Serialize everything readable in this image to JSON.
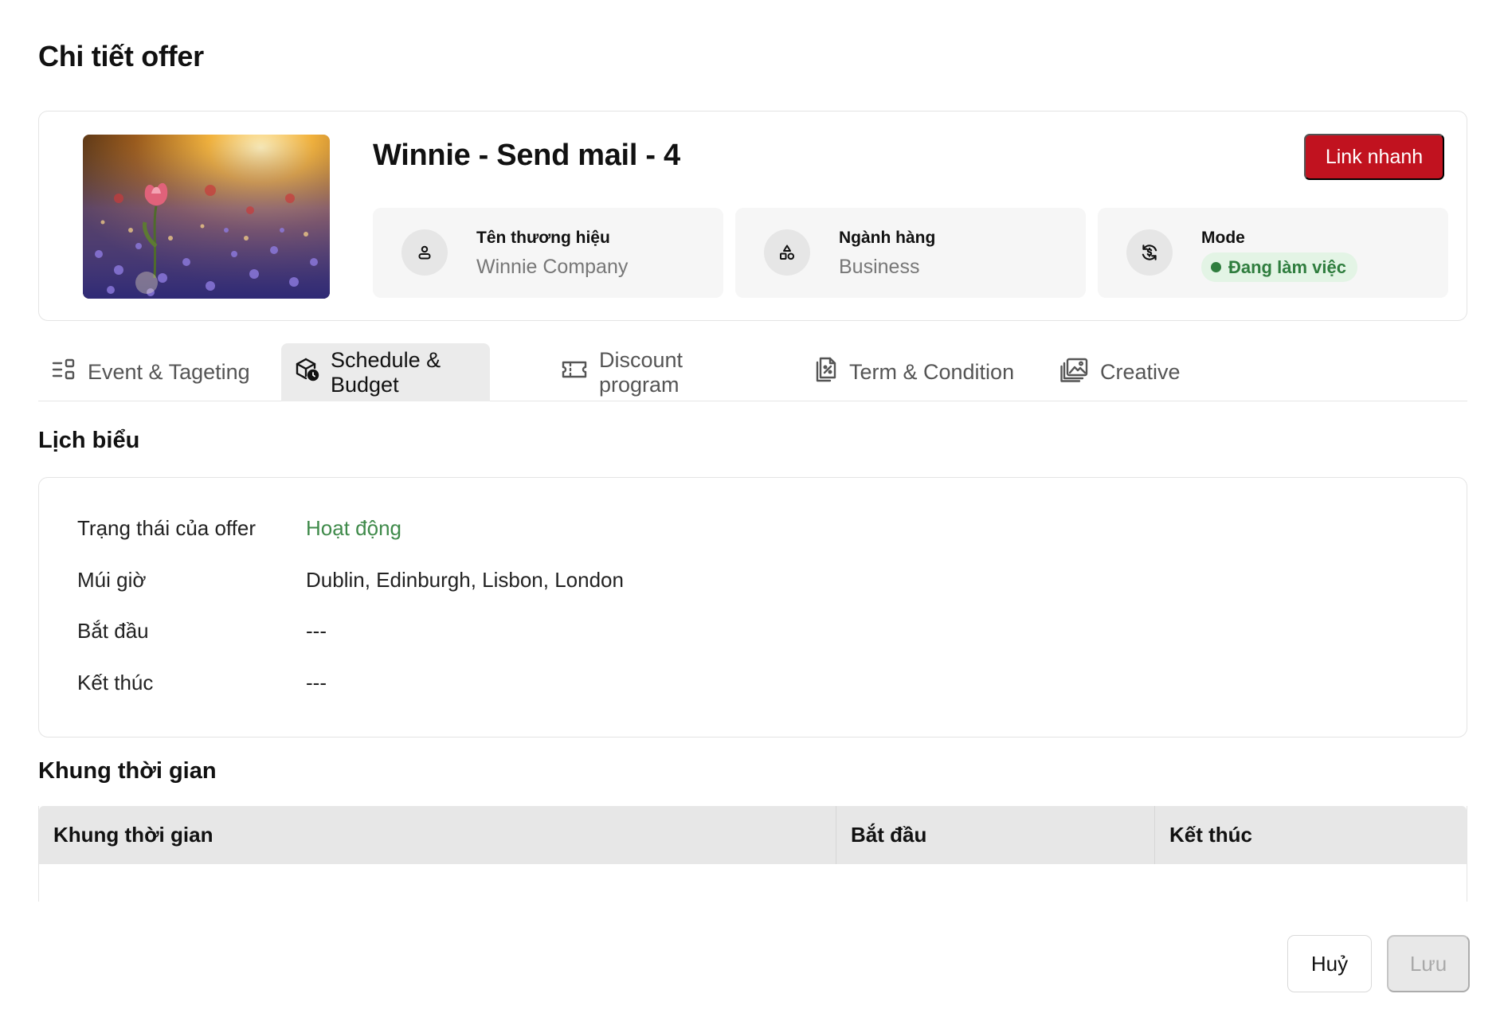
{
  "page": {
    "title": "Chi tiết offer"
  },
  "offer": {
    "name": "Winnie - Send mail - 4",
    "quick_link_label": "Link nhanh",
    "brand": {
      "label": "Tên thương hiệu",
      "value": "Winnie Company",
      "icon": "user-icon"
    },
    "industry": {
      "label": "Ngành hàng",
      "value": "Business",
      "icon": "shapes-icon"
    },
    "mode": {
      "label": "Mode",
      "value": "Đang làm việc",
      "icon": "sync-icon",
      "status_color": "#2f7d3e"
    }
  },
  "tabs": [
    {
      "label": "Event & Tageting",
      "icon": "targeting-icon",
      "active": false
    },
    {
      "label": "Schedule & Budget",
      "icon": "schedule-budget-icon",
      "active": true
    },
    {
      "label": "Discount program",
      "icon": "ticket-icon",
      "active": false
    },
    {
      "label": "Term & Condition",
      "icon": "document-icon",
      "active": false
    },
    {
      "label": "Creative",
      "icon": "gallery-icon",
      "active": false
    }
  ],
  "schedule": {
    "title": "Lịch biểu",
    "rows": [
      {
        "label": "Trạng thái của offer",
        "value": "Hoạt động"
      },
      {
        "label": "Múi giờ",
        "value": "Dublin, Edinburgh, Lisbon, London"
      },
      {
        "label": "Bắt đầu",
        "value": "---"
      },
      {
        "label": "Kết thúc",
        "value": "---"
      }
    ]
  },
  "timeframe": {
    "title": "Khung thời gian",
    "columns": [
      "Khung thời gian",
      "Bắt đầu",
      "Kết thúc"
    ]
  },
  "footer": {
    "cancel_label": "Huỷ",
    "save_label": "Lưu"
  },
  "colors": {
    "accent": "#c1121f",
    "success": "#3f8a4a"
  }
}
